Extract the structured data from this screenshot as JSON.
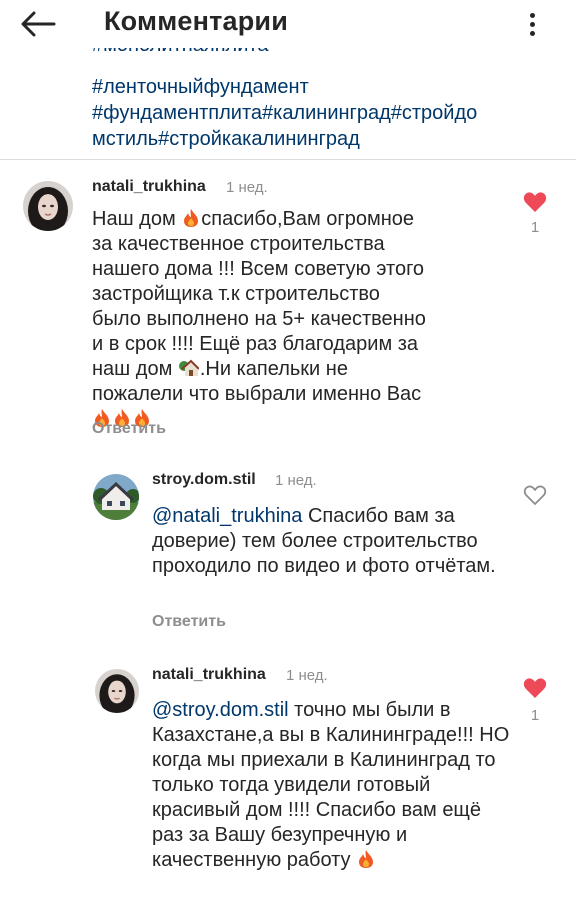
{
  "header": {
    "title": "Комментарии",
    "back_icon": "arrow-left-icon",
    "more_icon": "more-vertical-icon"
  },
  "caption": {
    "clipped_hashtag": "#монолитнаяплита",
    "lines": [
      "#ленточныйфундамент",
      "#фундаментплита#калининград#стройдо",
      "мстиль#стройкакалининград"
    ]
  },
  "comments": [
    {
      "username": "natali_trukhina",
      "time": "1 нед.",
      "text_segments": [
        "Наш дом ",
        "спасибо,Вам огромное за качественное строительства нашего дома !!! Всем советую этого застройщика т.к строительство было выполнено на 5+ качественно и в срок !!!! Ещё раз благодарим за наш дом ",
        ".Ни капельки не пожалели что выбрали именно Вас "
      ],
      "reply_label": "Ответить",
      "liked": true,
      "likes": "1"
    },
    {
      "username": "stroy.dom.stil",
      "time": "1 нед.",
      "mention": "@natali_trukhina",
      "text": " Спасибо вам за доверие) тем более строительство проходило по видео и фото отчётам.",
      "reply_label": "Ответить",
      "liked": false
    },
    {
      "username": "natali_trukhina",
      "time": "1 нед.",
      "mention": "@stroy.dom.stil",
      "text": " точно мы были в Казахстане,а вы в Калининграде!!! НО  когда мы приехали в Калининград то только тогда увидели готовый красивый дом !!!! Спасибо вам ещё раз за Вашу безупречную и качественную работу ",
      "liked": true,
      "likes": "1"
    }
  ],
  "colors": {
    "text": "#262626",
    "secondary": "#8e8e8e",
    "link": "#00376b",
    "like_red": "#ed4956",
    "divider": "#dbdbdb"
  }
}
